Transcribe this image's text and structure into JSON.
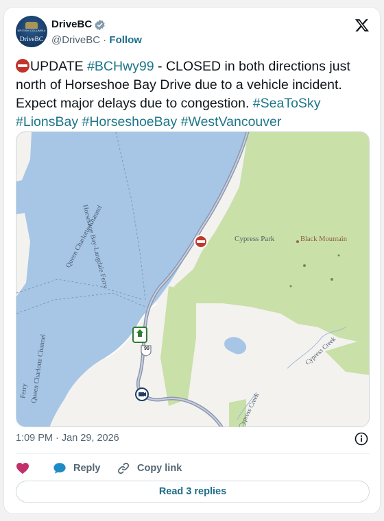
{
  "account": {
    "name": "DriveBC",
    "handle": "@DriveBC",
    "separator": "·",
    "follow_label": "Follow",
    "avatar_text": "DriveBC",
    "avatar_small_text": "BRITISH COLUMBIA"
  },
  "tweet": {
    "emoji": "no-entry-icon",
    "update_word": "UPDATE",
    "hashtag_main": "#BCHwy99",
    "body": " - CLOSED in both directions just north of Horseshoe Bay Drive due to a vehicle incident. Expect major delays due to congestion. ",
    "hashtags": [
      "#SeaToSky",
      "#LionsBay",
      "#HorseshoeBay",
      "#WestVancouver"
    ]
  },
  "map": {
    "labels": {
      "cypress_park": "Cypress Park",
      "black_mountain": "Black Mountain",
      "ferry_route": "Horseshoe Bay-Langdale Ferry",
      "channel_1": "Queen Charlotte Channel",
      "channel_2": "Queen Charlotte Channel",
      "channel_3": "Ferry",
      "cypress_creek_1": "Cypress Creek",
      "cypress_creek_2": "Cypress Creek",
      "highway_shield": "99"
    },
    "colors": {
      "water": "#a7c6e6",
      "park": "#c9e0a8",
      "land": "#f3f2ef",
      "road": "#8c98b0",
      "closure": "#c0392b"
    }
  },
  "meta": {
    "timestamp": "1:09 PM · Jan 29, 2026"
  },
  "actions": {
    "reply_label": "Reply",
    "copy_link_label": "Copy link",
    "read_replies_label": "Read 3 replies"
  }
}
